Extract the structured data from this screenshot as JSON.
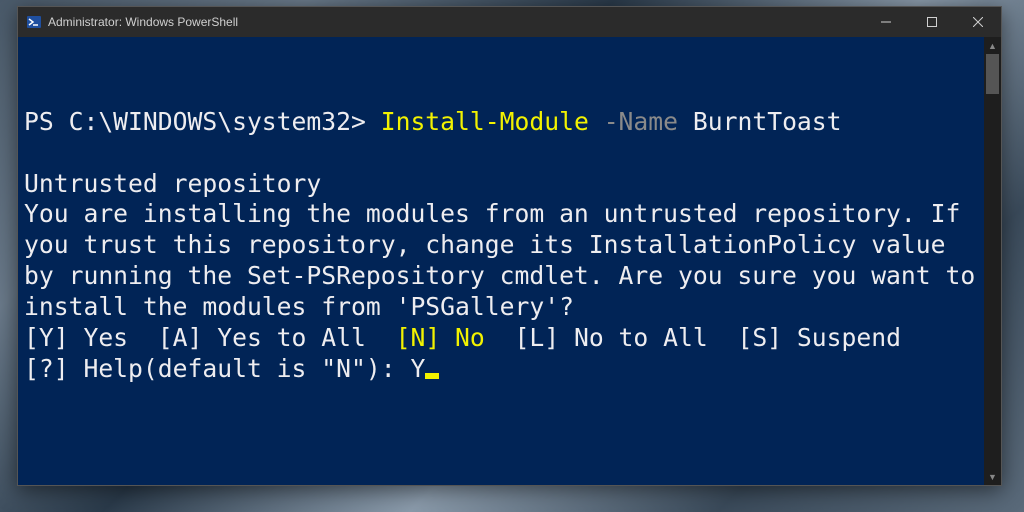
{
  "window": {
    "title": "Administrator: Windows PowerShell"
  },
  "terminal": {
    "prompt": "PS C:\\WINDOWS\\system32> ",
    "command": {
      "cmdlet": "Install-Module",
      "param_flag": "-Name",
      "param_value": "BurntToast"
    },
    "warning_title": "Untrusted repository",
    "warning_body": "You are installing the modules from an untrusted repository. If you trust this repository, change its InstallationPolicy value by running the Set-PSRepository cmdlet. Are you sure you want to  install the modules from 'PSGallery'?",
    "options_line1_pre": "[Y] Yes  [A] Yes to All  ",
    "options_line1_highlight": "[N] No",
    "options_line1_post": "  [L] No to All  [S] Suspend ",
    "options_line2_pre": "[?] Help(default is \"N\"): ",
    "user_input": "Y"
  },
  "colors": {
    "terminal_bg": "#012456",
    "terminal_fg": "#eeedf0",
    "highlight": "#f2f200",
    "param_gray": "#8a8a8a"
  }
}
